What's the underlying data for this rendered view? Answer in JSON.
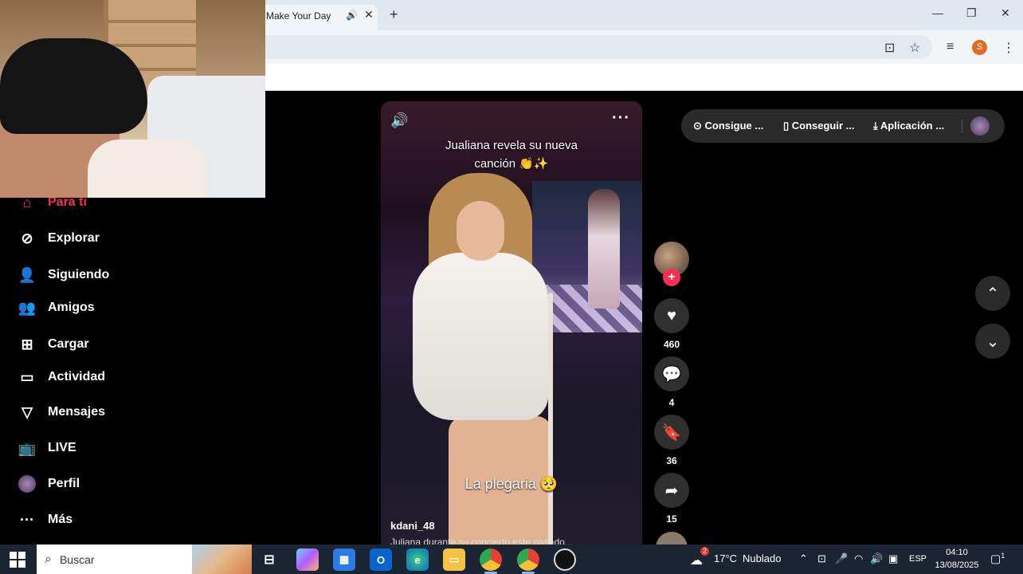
{
  "browser": {
    "tab_title": "Make Your Day",
    "tab_audio_icon": "speaker-icon",
    "new_tab_label": "+",
    "profile_initial": "S"
  },
  "sidebar": {
    "items": [
      {
        "label": "Para ti",
        "icon": "home-icon",
        "active": true
      },
      {
        "label": "Explorar",
        "icon": "compass-icon"
      },
      {
        "label": "Siguiendo",
        "icon": "following-icon"
      },
      {
        "label": "Amigos",
        "icon": "friends-icon"
      },
      {
        "label": "Cargar",
        "icon": "upload-icon"
      },
      {
        "label": "Actividad",
        "icon": "activity-icon"
      },
      {
        "label": "Mensajes",
        "icon": "messages-icon"
      },
      {
        "label": "LIVE",
        "icon": "live-icon"
      },
      {
        "label": "Perfil",
        "icon": "profile-avatar"
      },
      {
        "label": "Más",
        "icon": "more-icon"
      }
    ]
  },
  "video": {
    "caption_line1": "Jualiana revela su nueva",
    "caption_line2": "canción 👏✨",
    "overlay_text": "La plegaria 🥺",
    "username": "kdani_48",
    "description": "Juliana durante su concierto este pasado..."
  },
  "actions": {
    "likes": "460",
    "comments": "4",
    "saves": "36",
    "shares": "15"
  },
  "topbar": {
    "item1": "Consigue ...",
    "item2": "Conseguir ...",
    "item3": "Aplicación ..."
  },
  "taskbar": {
    "search_placeholder": "Buscar",
    "weather_temp": "17°C",
    "weather_desc": "Nublado",
    "language": "ESP",
    "time": "04:10",
    "date": "13/08/2025",
    "notification_count": "1",
    "weather_badge": "2"
  },
  "colors": {
    "accent": "#fe2c55",
    "taskbar": "#1b2432",
    "chrome_frame": "#dfe8ee"
  }
}
